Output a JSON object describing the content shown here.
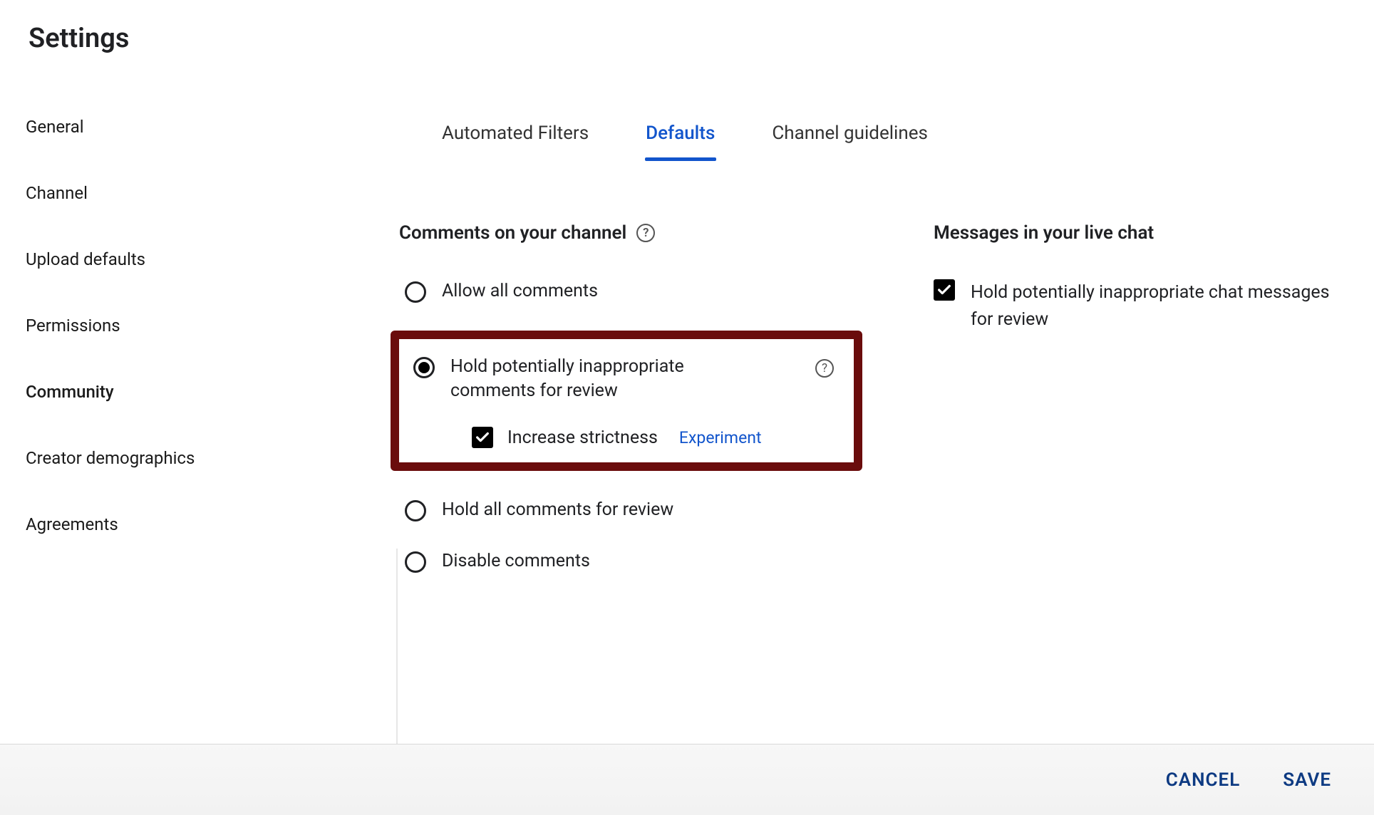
{
  "page_title": "Settings",
  "sidebar": {
    "items": [
      {
        "label": "General",
        "selected": false
      },
      {
        "label": "Channel",
        "selected": false
      },
      {
        "label": "Upload defaults",
        "selected": false
      },
      {
        "label": "Permissions",
        "selected": false
      },
      {
        "label": "Community",
        "selected": true
      },
      {
        "label": "Creator demographics",
        "selected": false
      },
      {
        "label": "Agreements",
        "selected": false
      }
    ]
  },
  "tabs": [
    {
      "label": "Automated Filters",
      "active": false
    },
    {
      "label": "Defaults",
      "active": true
    },
    {
      "label": "Channel guidelines",
      "active": false
    }
  ],
  "comments_section": {
    "title": "Comments on your channel",
    "options": {
      "allow_all": "Allow all comments",
      "hold_inappropriate": "Hold potentially inappropriate comments for review",
      "increase_strictness": "Increase strictness",
      "increase_strictness_badge": "Experiment",
      "hold_all": "Hold all comments for review",
      "disable": "Disable comments"
    },
    "selected": "hold_inappropriate",
    "increase_strictness_checked": true
  },
  "livechat_section": {
    "title": "Messages in your live chat",
    "option_label": "Hold potentially inappropriate chat messages for review",
    "checked": true
  },
  "footer": {
    "cancel": "CANCEL",
    "save": "SAVE"
  }
}
